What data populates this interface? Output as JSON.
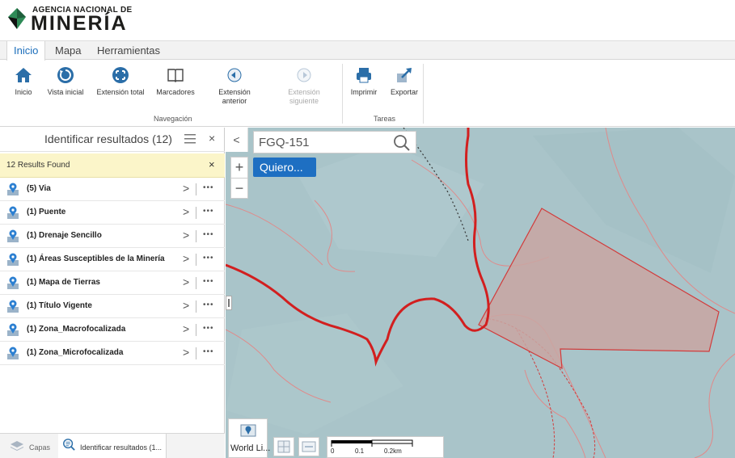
{
  "header": {
    "logo_top": "AGENCIA NACIONAL DE",
    "logo_main": "MINERÍA",
    "logo_icon": "diamond-logo-icon"
  },
  "ribbon": {
    "tabs": [
      {
        "label": "Inicio",
        "active": true
      },
      {
        "label": "Mapa",
        "active": false
      },
      {
        "label": "Herramientas",
        "active": false
      }
    ],
    "buttons": [
      {
        "label": "Inicio",
        "icon": "home-icon",
        "enabled": true
      },
      {
        "label": "Vista inicial",
        "icon": "refresh-icon",
        "enabled": true
      },
      {
        "label": "Extensión total",
        "icon": "full-extent-icon",
        "enabled": true
      },
      {
        "label": "Marcadores",
        "icon": "book-icon",
        "enabled": true
      },
      {
        "label": "Extensión anterior",
        "icon": "arrow-left-icon",
        "enabled": true
      },
      {
        "label": "Extensión siguiente",
        "icon": "arrow-right-icon",
        "enabled": false
      },
      {
        "label": "Imprimir",
        "icon": "print-icon",
        "enabled": true
      },
      {
        "label": "Exportar",
        "icon": "export-icon",
        "enabled": true
      }
    ],
    "groups": [
      {
        "label": "Navegación"
      },
      {
        "label": "Tareas"
      }
    ]
  },
  "panel": {
    "title": "Identificar resultados (12)",
    "close": "×",
    "results_text": "12 Results Found",
    "results_close": "×",
    "items": [
      {
        "label": "(5) Via"
      },
      {
        "label": "(1) Puente"
      },
      {
        "label": "(1) Drenaje Sencillo"
      },
      {
        "label": "(1) Áreas Susceptibles de la Minería"
      },
      {
        "label": "(1) Mapa de Tierras"
      },
      {
        "label": "(1) Título Vigente"
      },
      {
        "label": "(1) Zona_Macrofocalizada"
      },
      {
        "label": "(1) Zona_Microfocalizada"
      }
    ],
    "chevron": ">",
    "more": "•••",
    "footer_tabs": [
      {
        "label": "Capas",
        "icon": "layers-icon",
        "active": false
      },
      {
        "label": "Identificar resultados (1...",
        "icon": "identify-icon",
        "active": true
      }
    ]
  },
  "map": {
    "collapse": "<",
    "zoom_in": "+",
    "zoom_out": "−",
    "search_value": "FGQ-151",
    "quiero_label": "Quiero...",
    "basemap_label": "World Li...",
    "scale_labels": [
      "0",
      "0.1",
      "0.2km"
    ],
    "colors": {
      "background": "#a9c4c9",
      "road_red": "#d21f1f",
      "polygon_fill": "#c9a6a2",
      "polygon_stroke": "#d23b3b",
      "thin_lines": "#e08a8a"
    }
  }
}
